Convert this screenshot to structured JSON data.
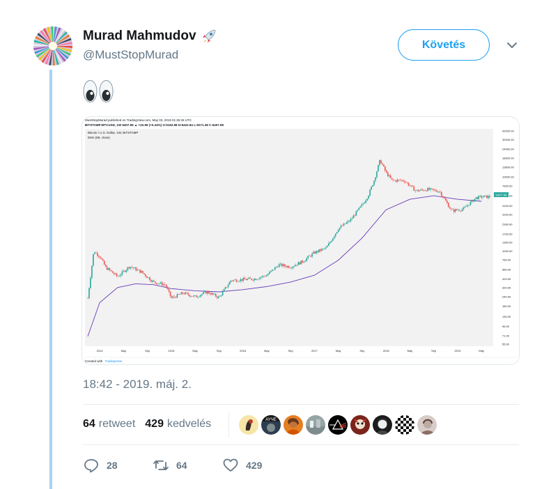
{
  "author": {
    "name": "Murad Mahmudov",
    "handle": "@MustStopMurad",
    "name_emoji": "rocket-icon"
  },
  "follow_button_label": "Követés",
  "tweet": {
    "text_emoji": "eyes-emoji"
  },
  "chart_header": {
    "line1": "MustStopMurad published on TradingView.com, May 03, 2019 01:25:26 UTC",
    "line2": "BITSTAMP:BTCUSD, 1W  5407.99 ▲ +22.99 (+0.43%)  O:5152.98  H:5422.94  L:5071.38  C:5407.99",
    "subtitle": "Bitcoin / U.S. Dollar, 1W, BITSTAMP",
    "indicator": "EMA (89, close)",
    "footer_prefix": "Created with",
    "footer_brand": "TradingView"
  },
  "chart_data": {
    "type": "line",
    "title": "Bitcoin / U.S. Dollar, 1W, BITSTAMP",
    "scale": "log",
    "price_tag": "5407.99",
    "x_ticks": [
      "2014",
      "May",
      "Sep",
      "2015",
      "May",
      "Sep",
      "2016",
      "May",
      "Sep",
      "2017",
      "May",
      "Sep",
      "2018",
      "May",
      "Sep",
      "2019",
      "May"
    ],
    "y_ticks": [
      "42000.00",
      "32000.00",
      "24000.00",
      "18000.00",
      "13600.00",
      "10000.00",
      "7600.00",
      "5600.00",
      "4100.00",
      "3100.00",
      "2300.00",
      "1700.00",
      "1300.00",
      "1000.00",
      "760.00",
      "560.00",
      "420.00",
      "320.00",
      "240.00",
      "180.00",
      "130.00",
      "96.00",
      "71.00",
      "55.00"
    ],
    "ylim": [
      55,
      42000
    ],
    "series": [
      {
        "name": "Bitcoin / U.S. Dollar",
        "color": "#26a69a",
        "down_color": "#ef5350",
        "x": [
          "2013-11",
          "2013-12",
          "2014-01",
          "2014-02",
          "2014-04",
          "2014-06",
          "2014-08",
          "2014-10",
          "2014-12",
          "2015-01",
          "2015-03",
          "2015-05",
          "2015-07",
          "2015-09",
          "2015-11",
          "2016-01",
          "2016-03",
          "2016-05",
          "2016-07",
          "2016-09",
          "2016-11",
          "2017-01",
          "2017-03",
          "2017-05",
          "2017-07",
          "2017-09",
          "2017-10",
          "2017-11",
          "2017-12",
          "2018-01",
          "2018-02",
          "2018-04",
          "2018-06",
          "2018-08",
          "2018-10",
          "2018-12",
          "2019-02",
          "2019-04",
          "2019-05"
        ],
        "values": [
          230,
          1000,
          850,
          600,
          450,
          620,
          520,
          380,
          350,
          230,
          270,
          240,
          280,
          235,
          400,
          410,
          420,
          470,
          650,
          610,
          720,
          950,
          1100,
          2000,
          2600,
          4200,
          5600,
          9000,
          17000,
          11500,
          9000,
          9000,
          6500,
          6800,
          6400,
          3500,
          3700,
          5200,
          5408
        ]
      },
      {
        "name": "EMA (89, close)",
        "color": "#673ab7",
        "x": [
          "2013-11",
          "2014-01",
          "2014-04",
          "2014-07",
          "2014-10",
          "2015-01",
          "2015-05",
          "2015-09",
          "2016-01",
          "2016-05",
          "2016-09",
          "2017-01",
          "2017-05",
          "2017-09",
          "2018-01",
          "2018-05",
          "2018-09",
          "2019-01",
          "2019-05"
        ],
        "values": [
          70,
          200,
          320,
          360,
          350,
          310,
          290,
          280,
          300,
          330,
          380,
          470,
          750,
          1500,
          3600,
          5000,
          5600,
          5000,
          4700
        ]
      }
    ]
  },
  "timestamp": "18:42 - 2019. máj. 2.",
  "stats": {
    "retweets_count": "64",
    "retweets_label": "retweet",
    "likes_count": "429",
    "likes_label": "kedvelés"
  },
  "likers": [
    {
      "name": "liker-avatar-1"
    },
    {
      "name": "liker-avatar-2"
    },
    {
      "name": "liker-avatar-3"
    },
    {
      "name": "liker-avatar-4"
    },
    {
      "name": "liker-avatar-5"
    },
    {
      "name": "liker-avatar-6"
    },
    {
      "name": "liker-avatar-7"
    },
    {
      "name": "liker-avatar-8"
    },
    {
      "name": "liker-avatar-9"
    }
  ],
  "actions": {
    "replies": "28",
    "retweets": "64",
    "likes": "429"
  },
  "colors": {
    "accent": "#1da1f2",
    "thread_line": "#a8d4ef",
    "secondary_text": "#657786"
  }
}
